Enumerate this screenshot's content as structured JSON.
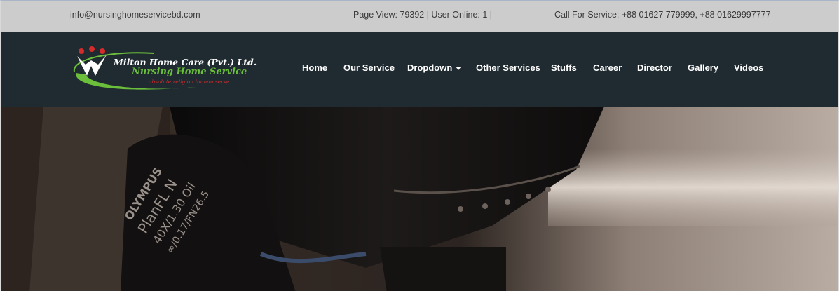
{
  "topbar": {
    "email": "info@nursinghomeservicebd.com",
    "stats": "Page View: 79392 | User Online: 1 |",
    "call": "Call For Service: +88 01627 779999, +88 01629997777"
  },
  "logo": {
    "line1": "Milton Home Care (Pvt.) Ltd.",
    "line2": "Nursing Home Service",
    "line3": "absolute religion human serve"
  },
  "nav": {
    "items": [
      {
        "label": "Home"
      },
      {
        "label": "Our Service"
      },
      {
        "label": "Dropdown",
        "icon": "caret-down-icon"
      },
      {
        "label": "Other Services"
      },
      {
        "label": "Stuffs"
      },
      {
        "label": "Career"
      },
      {
        "label": "Director"
      },
      {
        "label": "Gallery"
      },
      {
        "label": "Videos"
      }
    ]
  },
  "hero": {
    "lens_text": [
      "OLYMPUS",
      "PlanFL N",
      "40X/1.30 Oil",
      "∞/0.17/FN26.5"
    ]
  },
  "colors": {
    "topbar_bg": "#cccccc",
    "navbar_bg": "#1f2b31",
    "logo_green": "#6bbf3a",
    "logo_red": "#d62b2b"
  }
}
